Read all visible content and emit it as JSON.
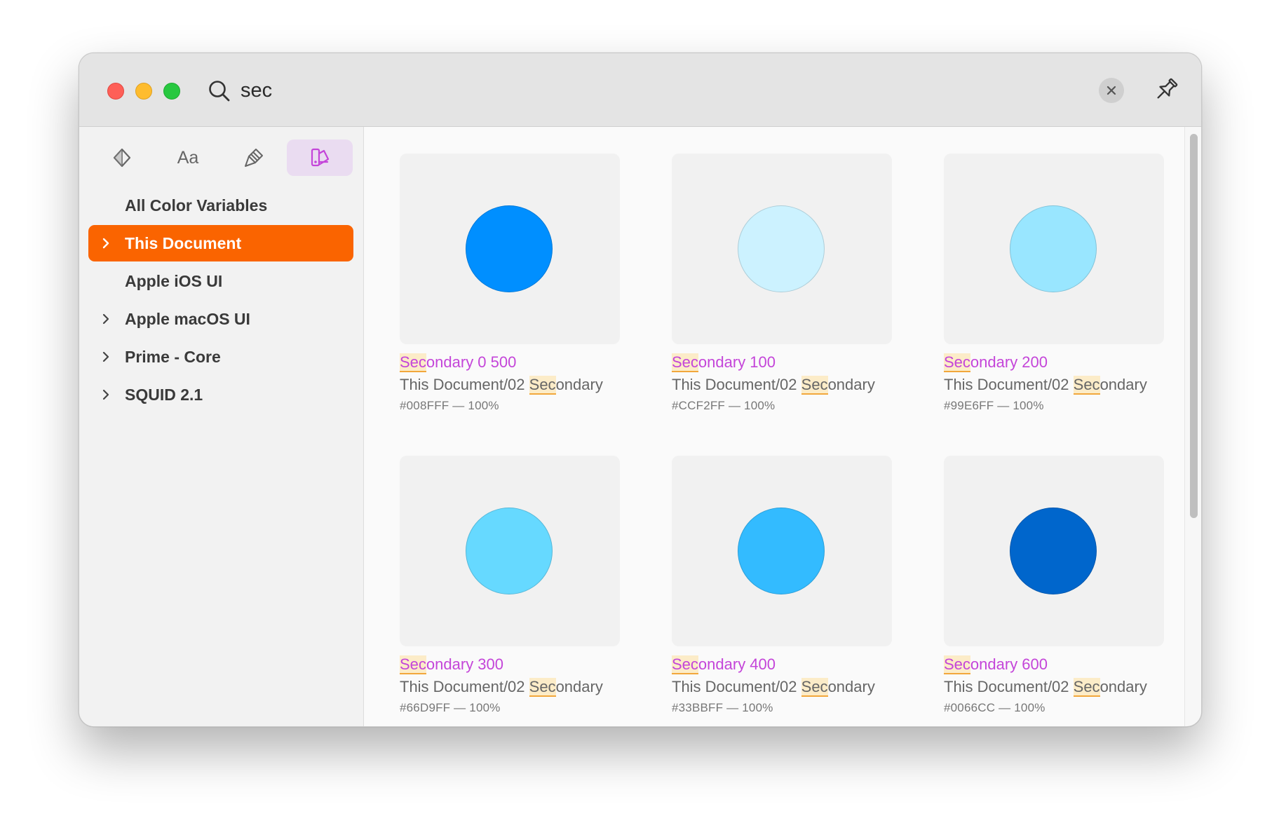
{
  "search": {
    "query": "sec",
    "placeholder": ""
  },
  "icons": {
    "search": "search-icon",
    "clear": "close-icon",
    "pin": "pin-icon",
    "components": "diamond-icon",
    "layers": "paintbrush-icon",
    "colors": "color-swatch-icon",
    "chevron": "chevron-right-icon"
  },
  "tabs": {
    "text_label": "Aa"
  },
  "sidebar": {
    "items": [
      {
        "label": "All Color Variables",
        "expandable": false,
        "selected": false
      },
      {
        "label": "This Document",
        "expandable": true,
        "selected": true
      },
      {
        "label": "Apple iOS UI",
        "expandable": false,
        "selected": false
      },
      {
        "label": "Apple macOS UI",
        "expandable": true,
        "selected": false
      },
      {
        "label": "Prime - Core",
        "expandable": true,
        "selected": false
      },
      {
        "label": "SQUID 2.1",
        "expandable": true,
        "selected": false
      }
    ]
  },
  "colors_grid": [
    {
      "name": "Secondary 0 500",
      "name_match": "Sec",
      "name_rest": "ondary 0 500",
      "path_prefix": "This Document/02 ",
      "path_match": "Sec",
      "path_rest": "ondary",
      "hex_label": "#008FFF — 100%",
      "color": "#008FFF"
    },
    {
      "name": "Secondary 100",
      "name_match": "Sec",
      "name_rest": "ondary 100",
      "path_prefix": "This Document/02 ",
      "path_match": "Sec",
      "path_rest": "ondary",
      "hex_label": "#CCF2FF — 100%",
      "color": "#CCF2FF"
    },
    {
      "name": "Secondary 200",
      "name_match": "Sec",
      "name_rest": "ondary 200",
      "path_prefix": "This Document/02 ",
      "path_match": "Sec",
      "path_rest": "ondary",
      "hex_label": "#99E6FF — 100%",
      "color": "#99E6FF"
    },
    {
      "name": "Secondary 300",
      "name_match": "Sec",
      "name_rest": "ondary 300",
      "path_prefix": "This Document/02 ",
      "path_match": "Sec",
      "path_rest": "ondary",
      "hex_label": "#66D9FF — 100%",
      "color": "#66D9FF"
    },
    {
      "name": "Secondary 400",
      "name_match": "Sec",
      "name_rest": "ondary 400",
      "path_prefix": "This Document/02 ",
      "path_match": "Sec",
      "path_rest": "ondary",
      "hex_label": "#33BBFF — 100%",
      "color": "#33BBFF"
    },
    {
      "name": "Secondary 600",
      "name_match": "Sec",
      "name_rest": "ondary 600",
      "path_prefix": "This Document/02 ",
      "path_match": "Sec",
      "path_rest": "ondary",
      "hex_label": "#0066CC — 100%",
      "color": "#0066CC"
    }
  ],
  "theme": {
    "accent": "#FA6400",
    "match_text": "#C445D9",
    "active_tab_bg": "#EADCF1"
  }
}
